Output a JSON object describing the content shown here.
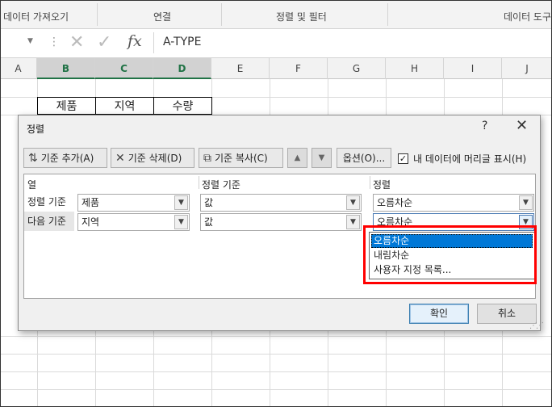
{
  "ribbon": {
    "groups": [
      "데이터 가져오기",
      "연결",
      "정렬 및 필터",
      "데이터 도구"
    ]
  },
  "formula_bar": {
    "value": "A-TYPE",
    "fx_label": "fx"
  },
  "sheet": {
    "columns": [
      "A",
      "B",
      "C",
      "D",
      "E",
      "F",
      "G",
      "H",
      "I",
      "J"
    ],
    "selected_columns": [
      "B",
      "C",
      "D"
    ],
    "header_cells": [
      "제품",
      "지역",
      "수량"
    ]
  },
  "dialog": {
    "title": "정렬",
    "help": "?",
    "toolbar": {
      "add": "기준 추가(A)",
      "delete": "기준 삭제(D)",
      "copy": "기준 복사(C)",
      "options": "옵션(O)...",
      "has_headers": "내 데이터에 머리글 표시(H)",
      "has_headers_checked": true
    },
    "grid": {
      "headers": [
        "열",
        "정렬 기준",
        "정렬"
      ],
      "rows": [
        {
          "label": "정렬 기준",
          "column": "제품",
          "sort_on": "값",
          "order": "오름차순"
        },
        {
          "label": "다음 기준",
          "column": "지역",
          "sort_on": "값",
          "order": "오름차순"
        }
      ]
    },
    "ok": "확인",
    "cancel": "취소"
  },
  "dropdown": {
    "options": [
      "오름차순",
      "내림차순",
      "사용자 지정 목록..."
    ],
    "highlighted": "오름차순"
  },
  "colors": {
    "excel_green": "#217346",
    "highlight_blue": "#0078d7",
    "annotation_red": "#ff0000"
  }
}
